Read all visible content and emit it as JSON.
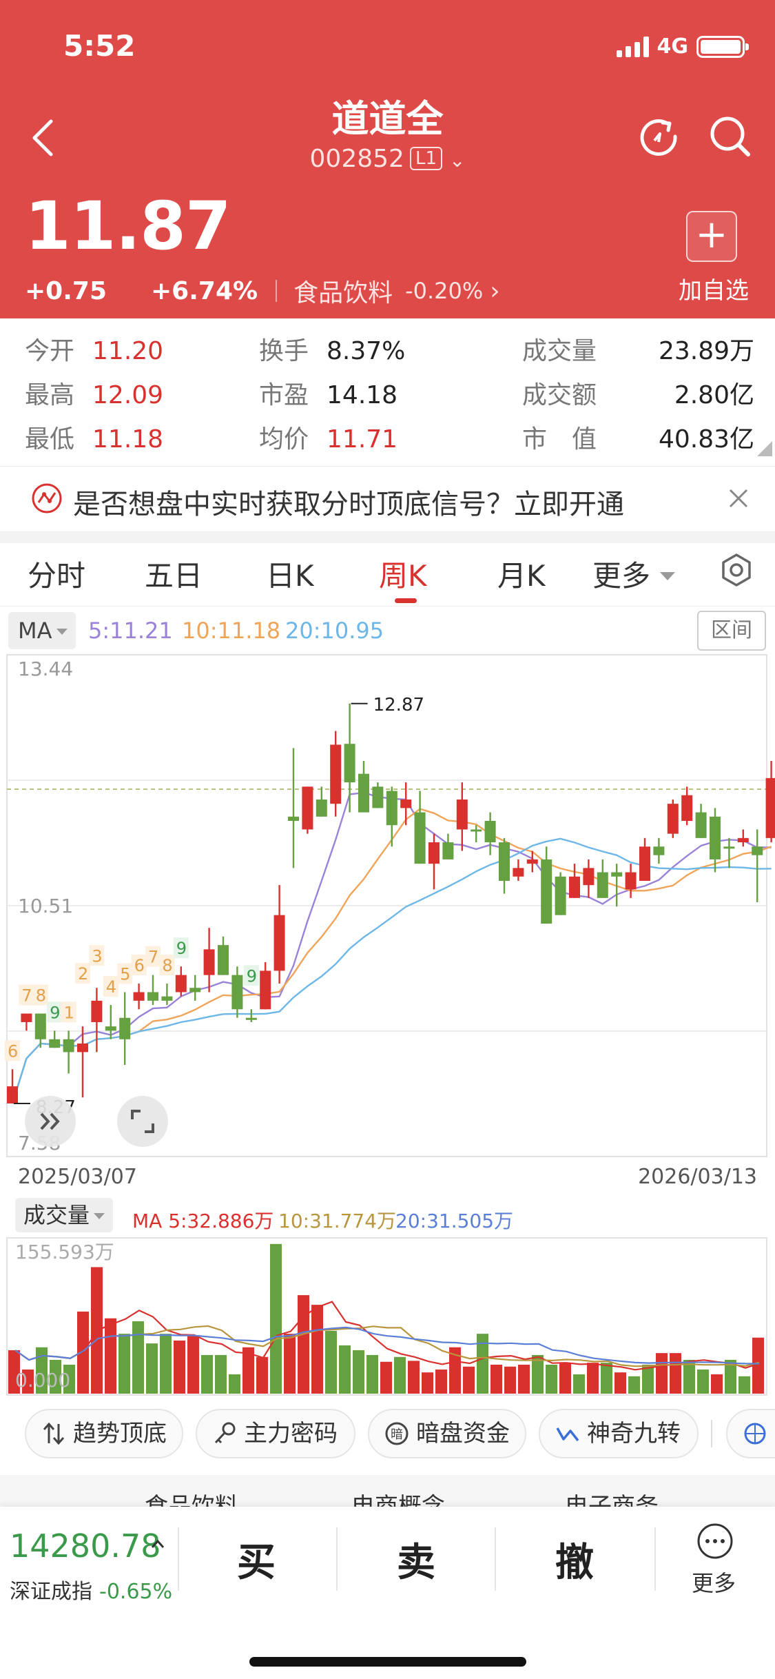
{
  "status_bar": {
    "time": "5:52",
    "network": "4G"
  },
  "header": {
    "name": "道道全",
    "code": "002852",
    "level": "L1",
    "price": "11.87",
    "change": "+0.75",
    "change_pct": "+6.74%",
    "sector": "食品饮料",
    "sector_pct": "-0.20%",
    "add_watchlist": "加自选"
  },
  "stats": [
    {
      "label": "今开",
      "value": "11.20",
      "color": "red"
    },
    {
      "label": "换手",
      "value": "8.37%",
      "color": "dark"
    },
    {
      "label": "成交量",
      "value": "23.89万",
      "color": "dark"
    },
    {
      "label": "最高",
      "value": "12.09",
      "color": "red"
    },
    {
      "label": "市盈",
      "value": "14.18",
      "color": "dark"
    },
    {
      "label": "成交额",
      "value": "2.80亿",
      "color": "dark"
    },
    {
      "label": "最低",
      "value": "11.18",
      "color": "red"
    },
    {
      "label": "均价",
      "value": "11.71",
      "color": "red"
    },
    {
      "label": "市　值",
      "value": "40.83亿",
      "color": "dark"
    }
  ],
  "banner": {
    "text": "是否想盘中实时获取分时顶底信号？立即开通"
  },
  "tabs": [
    "分时",
    "五日",
    "日K",
    "周K",
    "月K",
    "更多"
  ],
  "active_tab": "周K",
  "ma_legend": {
    "selector": "MA",
    "ma5": "5:11.21",
    "ma10": "10:11.18",
    "ma20": "20:10.95",
    "range_button": "区间"
  },
  "colors": {
    "up": "#d9312d",
    "down": "#65a041",
    "ma5": "#9a82d8",
    "ma10": "#f0a458",
    "ma20": "#6cb7e8",
    "header": "#dd4a48"
  },
  "chart_data": [
    {
      "type": "candlestick",
      "title": "",
      "y_ticks": [
        "13.44",
        "10.51",
        "7.58"
      ],
      "ylim": [
        7.58,
        13.44
      ],
      "x_start": "2025/03/07",
      "x_end": "2026/03/13",
      "max_label": "12.87",
      "min_label": "8.27",
      "candles": [
        [
          8.4,
          8.6,
          8.2,
          8.2,
          "up"
        ],
        [
          9.15,
          9.25,
          9.05,
          9.25,
          "up"
        ],
        [
          8.95,
          9.25,
          8.85,
          9.25,
          "down"
        ],
        [
          8.95,
          9.05,
          8.85,
          8.85,
          "down"
        ],
        [
          8.95,
          9.05,
          8.55,
          8.8,
          "down"
        ],
        [
          8.8,
          9.1,
          8.27,
          8.9,
          "up"
        ],
        [
          9.15,
          9.55,
          8.8,
          9.4,
          "up"
        ],
        [
          9.1,
          9.35,
          8.95,
          9.05,
          "down"
        ],
        [
          8.95,
          9.5,
          8.65,
          9.2,
          "down"
        ],
        [
          9.4,
          9.6,
          9.3,
          9.5,
          "up"
        ],
        [
          9.5,
          9.7,
          9.35,
          9.4,
          "down"
        ],
        [
          9.4,
          9.6,
          9.35,
          9.45,
          "down"
        ],
        [
          9.5,
          9.8,
          9.45,
          9.7,
          "up"
        ],
        [
          9.5,
          9.7,
          9.4,
          9.55,
          "down"
        ],
        [
          10.0,
          10.25,
          9.5,
          9.7,
          "up"
        ],
        [
          10.05,
          10.15,
          9.7,
          9.7,
          "down"
        ],
        [
          9.7,
          9.8,
          9.2,
          9.3,
          "down"
        ],
        [
          9.2,
          9.3,
          9.15,
          9.2,
          "down"
        ],
        [
          9.75,
          9.85,
          9.3,
          9.3,
          "up"
        ],
        [
          10.4,
          10.75,
          9.6,
          9.75,
          "up"
        ],
        [
          11.55,
          12.35,
          10.95,
          11.5,
          "down"
        ],
        [
          11.4,
          11.9,
          11.35,
          11.9,
          "up"
        ],
        [
          11.75,
          11.9,
          11.55,
          11.55,
          "down"
        ],
        [
          12.39,
          12.55,
          11.55,
          11.7,
          "up"
        ],
        [
          11.95,
          12.87,
          11.6,
          12.4,
          "down"
        ],
        [
          12.05,
          12.2,
          11.6,
          11.6,
          "down"
        ],
        [
          11.9,
          11.95,
          11.65,
          11.65,
          "down"
        ],
        [
          11.85,
          11.9,
          11.2,
          11.45,
          "down"
        ],
        [
          11.75,
          11.95,
          11.45,
          11.65,
          "up"
        ],
        [
          11.6,
          11.85,
          11.0,
          11.0,
          "down"
        ],
        [
          11.25,
          11.35,
          10.7,
          11.0,
          "up"
        ],
        [
          11.25,
          11.35,
          11.05,
          11.05,
          "down"
        ],
        [
          11.75,
          11.95,
          11.15,
          11.4,
          "up"
        ],
        [
          11.4,
          11.45,
          11.25,
          11.4,
          "down"
        ],
        [
          11.5,
          11.6,
          11.1,
          11.25,
          "down"
        ],
        [
          11.25,
          11.3,
          10.65,
          10.8,
          "down"
        ],
        [
          10.95,
          11.05,
          10.8,
          10.85,
          "up"
        ],
        [
          11.05,
          11.15,
          10.9,
          11.0,
          "up"
        ],
        [
          11.05,
          11.2,
          10.3,
          10.3,
          "down"
        ],
        [
          10.85,
          10.9,
          10.4,
          10.4,
          "down"
        ],
        [
          10.85,
          11.0,
          10.6,
          10.6,
          "up"
        ],
        [
          10.95,
          11.05,
          10.6,
          10.75,
          "up"
        ],
        [
          10.9,
          11.05,
          10.6,
          10.6,
          "down"
        ],
        [
          10.9,
          11.0,
          10.5,
          10.85,
          "down"
        ],
        [
          10.9,
          11.0,
          10.6,
          10.7,
          "up"
        ],
        [
          11.2,
          11.3,
          10.8,
          10.8,
          "up"
        ],
        [
          11.2,
          11.3,
          11.0,
          11.1,
          "down"
        ],
        [
          11.7,
          11.75,
          11.3,
          11.35,
          "up"
        ],
        [
          11.8,
          11.9,
          11.45,
          11.5,
          "up"
        ],
        [
          11.6,
          11.7,
          11.3,
          11.3,
          "down"
        ],
        [
          11.55,
          11.65,
          10.9,
          11.05,
          "down"
        ],
        [
          11.2,
          11.3,
          10.95,
          11.2,
          "down"
        ],
        [
          11.25,
          11.4,
          11.2,
          11.3,
          "up"
        ],
        [
          11.2,
          11.4,
          10.55,
          11.1,
          "down"
        ],
        [
          12.0,
          12.2,
          11.25,
          11.3,
          "up"
        ]
      ],
      "signal_labels": [
        "6",
        "7",
        "8",
        "9",
        "2",
        "1",
        "3",
        "4",
        "5",
        "6",
        "7",
        "8",
        "9"
      ]
    },
    {
      "type": "bar",
      "title": "成交量",
      "max_label": "155.593万",
      "min_label": "0.000",
      "ma5": "MA 5:32.886万",
      "ma10": "10:31.774万",
      "ma20": "20:31.505万",
      "bars": [
        [
          45,
          "up"
        ],
        [
          25,
          "up"
        ],
        [
          48,
          "down"
        ],
        [
          35,
          "down"
        ],
        [
          30,
          "down"
        ],
        [
          85,
          "up"
        ],
        [
          131,
          "up"
        ],
        [
          78,
          "up"
        ],
        [
          62,
          "down"
        ],
        [
          75,
          "down"
        ],
        [
          52,
          "down"
        ],
        [
          62,
          "down"
        ],
        [
          55,
          "up"
        ],
        [
          60,
          "up"
        ],
        [
          40,
          "down"
        ],
        [
          40,
          "down"
        ],
        [
          20,
          "down"
        ],
        [
          48,
          "up"
        ],
        [
          38,
          "up"
        ],
        [
          155,
          "down"
        ],
        [
          62,
          "up"
        ],
        [
          102,
          "up"
        ],
        [
          92,
          "up"
        ],
        [
          65,
          "down"
        ],
        [
          50,
          "down"
        ],
        [
          45,
          "down"
        ],
        [
          40,
          "down"
        ],
        [
          33,
          "up"
        ],
        [
          38,
          "down"
        ],
        [
          34,
          "up"
        ],
        [
          22,
          "up"
        ],
        [
          25,
          "up"
        ],
        [
          48,
          "up"
        ],
        [
          28,
          "up"
        ],
        [
          62,
          "down"
        ],
        [
          30,
          "up"
        ],
        [
          28,
          "up"
        ],
        [
          30,
          "up"
        ],
        [
          40,
          "down"
        ],
        [
          30,
          "down"
        ],
        [
          32,
          "up"
        ],
        [
          20,
          "down"
        ],
        [
          32,
          "up"
        ],
        [
          32,
          "down"
        ],
        [
          22,
          "up"
        ],
        [
          18,
          "down"
        ],
        [
          30,
          "down"
        ],
        [
          42,
          "up"
        ],
        [
          42,
          "up"
        ],
        [
          35,
          "down"
        ],
        [
          25,
          "down"
        ],
        [
          20,
          "up"
        ],
        [
          35,
          "down"
        ],
        [
          18,
          "down"
        ],
        [
          58,
          "up"
        ]
      ]
    }
  ],
  "tools": [
    "趋势顶底",
    "主力密码",
    "暗盘资金",
    "神奇九转"
  ],
  "partial_row": [
    "食品饮料",
    "电商概念",
    "电子商务"
  ],
  "bottom_bar": {
    "index_value": "14280.78",
    "index_name": "深证成指",
    "index_pct": "-0.65%",
    "buy": "买",
    "sell": "卖",
    "cancel": "撤",
    "more": "更多"
  }
}
